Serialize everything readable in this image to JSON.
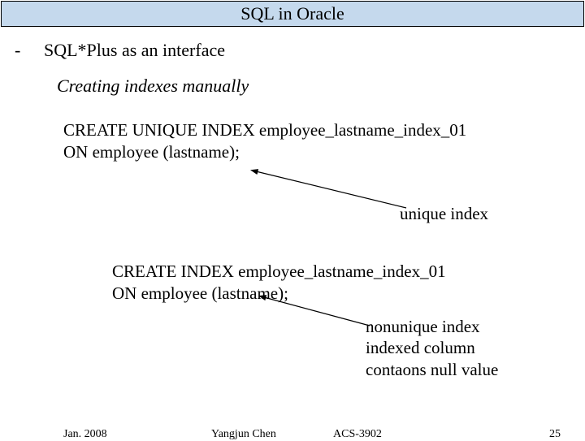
{
  "title": "SQL in Oracle",
  "bullet": {
    "dash": "-",
    "text": "SQL*Plus as an interface"
  },
  "subheading": "Creating indexes manually",
  "code1": {
    "line1": "CREATE UNIQUE INDEX employee_lastname_index_01",
    "line2": "ON employee (lastname);"
  },
  "annotation1": "unique index",
  "code2": {
    "line1": "CREATE INDEX employee_lastname_index_01",
    "line2": "ON employee (lastname);"
  },
  "annotation2": {
    "line1": "nonunique index",
    "line2": "indexed column",
    "line3": "contaons null value"
  },
  "footer": {
    "date": "Jan. 2008",
    "author": "Yangjun Chen",
    "course": "ACS-3902",
    "page": "25"
  }
}
